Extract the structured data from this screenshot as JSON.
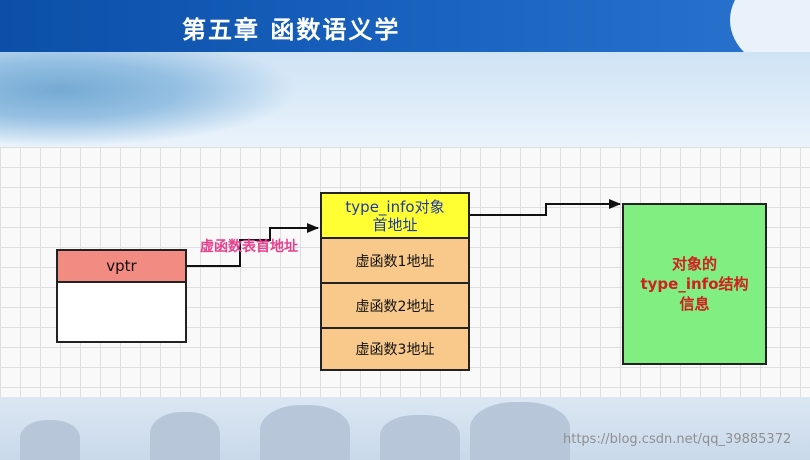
{
  "header": {
    "title": "第五章 函数语义学"
  },
  "diagram": {
    "vptr_label": "vptr",
    "link_label": "虚函数表首地址",
    "vtable": [
      "type_info对象\n首地址",
      "虚函数1地址",
      "虚函数2地址",
      "虚函数3地址"
    ],
    "typeinfo_label": "对象的\ntype_info结构\n信息"
  },
  "watermark": "https://blog.csdn.net/qq_39885372",
  "colors": {
    "header_blue": "#1a63c0",
    "vptr_header": "#f28b82",
    "vtable_first": "#ffff33",
    "vtable_cell": "#f8c98b",
    "typeinfo_box": "#80ee80",
    "label_pink": "#e6418d",
    "typeinfo_text": "#d11f1f"
  }
}
